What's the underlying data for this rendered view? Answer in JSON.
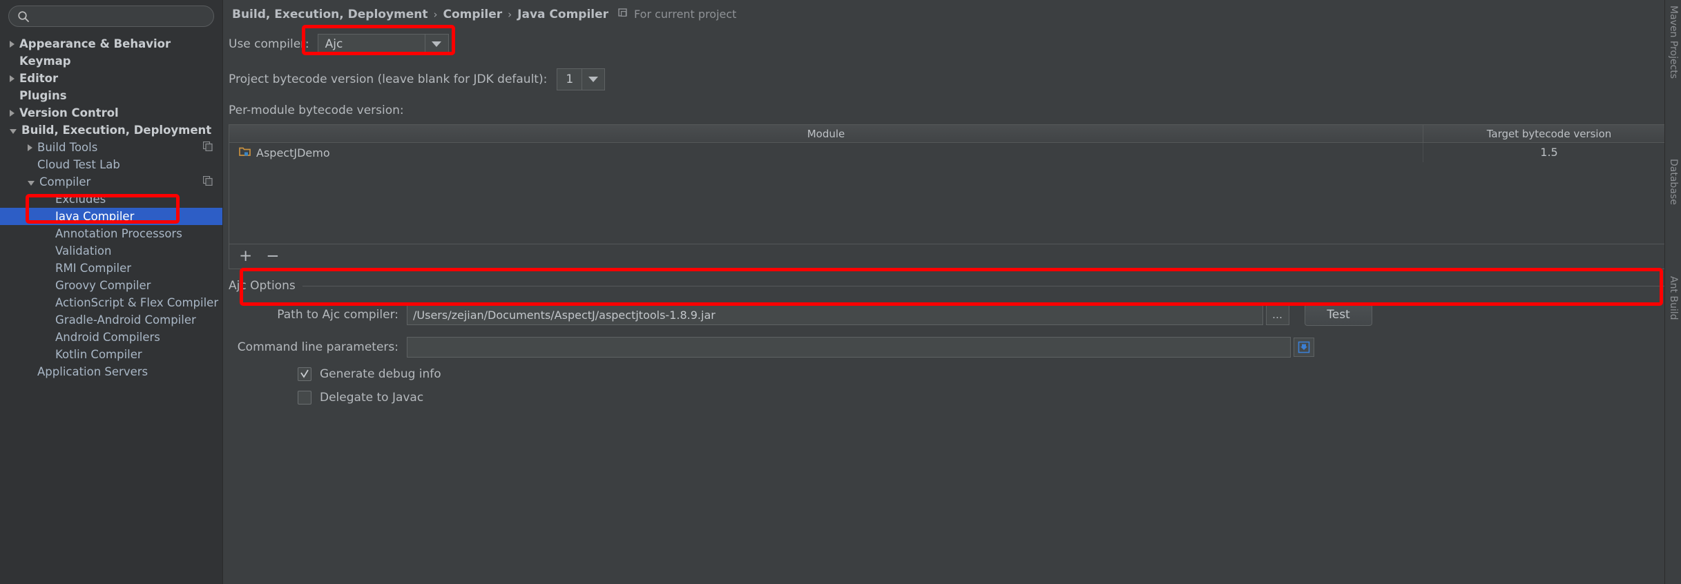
{
  "search": {
    "value": "",
    "placeholder": "",
    "icon": "search-icon"
  },
  "sidebar": {
    "items": [
      {
        "label": "Appearance & Behavior",
        "arrow": "right",
        "indent": 0,
        "bold": true,
        "selected": false
      },
      {
        "label": "Keymap",
        "arrow": "none",
        "indent": 0,
        "bold": true,
        "selected": false
      },
      {
        "label": "Editor",
        "arrow": "right",
        "indent": 0,
        "bold": true,
        "selected": false
      },
      {
        "label": "Plugins",
        "arrow": "none",
        "indent": 0,
        "bold": true,
        "selected": false
      },
      {
        "label": "Version Control",
        "arrow": "right",
        "indent": 0,
        "bold": true,
        "selected": false
      },
      {
        "label": "Build, Execution, Deployment",
        "arrow": "down",
        "indent": 0,
        "bold": true,
        "selected": false
      },
      {
        "label": "Build Tools",
        "arrow": "right",
        "indent": 1,
        "bold": false,
        "selected": false,
        "badge": "copy-icon"
      },
      {
        "label": "Cloud Test Lab",
        "arrow": "none",
        "indent": 1,
        "bold": false,
        "selected": false
      },
      {
        "label": "Compiler",
        "arrow": "down",
        "indent": 1,
        "bold": false,
        "selected": false,
        "badge": "copy-icon"
      },
      {
        "label": "Excludes",
        "arrow": "none",
        "indent": 2,
        "bold": false,
        "selected": false
      },
      {
        "label": "Java Compiler",
        "arrow": "none",
        "indent": 2,
        "bold": false,
        "selected": true
      },
      {
        "label": "Annotation Processors",
        "arrow": "none",
        "indent": 2,
        "bold": false,
        "selected": false
      },
      {
        "label": "Validation",
        "arrow": "none",
        "indent": 2,
        "bold": false,
        "selected": false
      },
      {
        "label": "RMI Compiler",
        "arrow": "none",
        "indent": 2,
        "bold": false,
        "selected": false
      },
      {
        "label": "Groovy Compiler",
        "arrow": "none",
        "indent": 2,
        "bold": false,
        "selected": false
      },
      {
        "label": "ActionScript & Flex Compiler",
        "arrow": "none",
        "indent": 2,
        "bold": false,
        "selected": false
      },
      {
        "label": "Gradle-Android Compiler",
        "arrow": "none",
        "indent": 2,
        "bold": false,
        "selected": false
      },
      {
        "label": "Android Compilers",
        "arrow": "none",
        "indent": 2,
        "bold": false,
        "selected": false
      },
      {
        "label": "Kotlin Compiler",
        "arrow": "none",
        "indent": 2,
        "bold": false,
        "selected": false
      },
      {
        "label": "Application Servers",
        "arrow": "none",
        "indent": 1,
        "bold": false,
        "selected": false
      }
    ]
  },
  "breadcrumb": {
    "parts": [
      "Build, Execution, Deployment",
      "Compiler",
      "Java Compiler"
    ],
    "separator": "›",
    "note": "For current project",
    "note_icon": "project-scope-icon"
  },
  "main": {
    "use_compiler_label": "Use compiler:",
    "use_compiler_value": "Ajc",
    "bytecode_label": "Project bytecode version (leave blank for JDK default):",
    "bytecode_value": "1",
    "per_module_label": "Per-module bytecode version:",
    "table": {
      "columns": [
        "Module",
        "Target bytecode version"
      ],
      "rows": [
        {
          "module": "AspectJDemo",
          "icon": "module-folder-icon",
          "target": "1.5"
        }
      ],
      "add_label": "+",
      "remove_label": "−"
    },
    "group_title": "Ajc Options",
    "path_label": "Path to Ajc compiler:",
    "path_value": "/Users/zejian/Documents/AspectJ/aspectjtools-1.8.9.jar",
    "browse_label": "…",
    "test_label": "Test",
    "cmdline_label": "Command line parameters:",
    "cmdline_value": "",
    "checkboxes": [
      {
        "label": "Generate debug info",
        "checked": true
      },
      {
        "label": "Delegate to Javac",
        "checked": false
      }
    ]
  },
  "right_strip": {
    "labels": [
      "Maven Projects",
      "Database",
      "Ant Build"
    ]
  },
  "colors": {
    "annotation": "#ff0000",
    "selection": "#2d5ec6",
    "panel_bg": "#3c3f41",
    "sidebar_bg": "#313335",
    "text": "#b5b9bd"
  }
}
